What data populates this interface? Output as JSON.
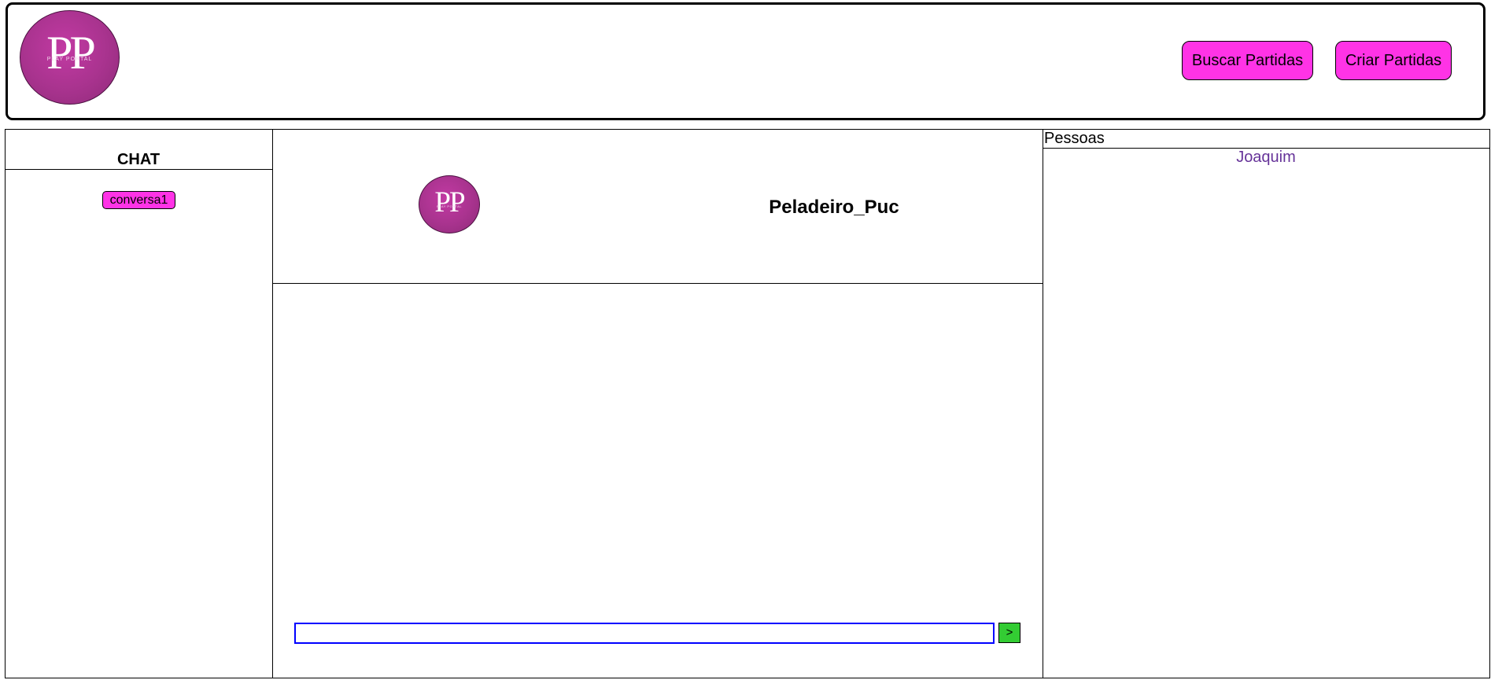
{
  "header": {
    "logo": {
      "monogram": "PP",
      "subtitle": "PLAY PORTAL",
      "icon": "play-portal-logo"
    },
    "buttons": {
      "buscar": "Buscar Partidas",
      "criar": "Criar Partidas"
    }
  },
  "chat_sidebar": {
    "title": "CHAT",
    "conversations": [
      "conversa1"
    ]
  },
  "chat_panel": {
    "contact_name": "Peladeiro_Puc",
    "avatar": {
      "monogram": "PP",
      "subtitle": "PLAY PORTAL"
    },
    "message_input": {
      "value": "",
      "placeholder": ""
    },
    "send_label": ">"
  },
  "people_panel": {
    "title": "Pessoas",
    "people": [
      "Joaquim"
    ]
  },
  "colors": {
    "button_pink": "#ff33e6",
    "logo_magenta": "#a8338e",
    "send_green": "#33cc33",
    "input_border": "#0000ff",
    "person_link": "#663399"
  }
}
